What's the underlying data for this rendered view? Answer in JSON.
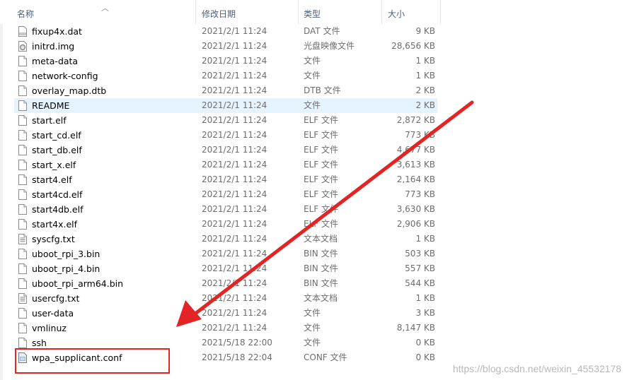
{
  "header": {
    "name": "名称",
    "date": "修改日期",
    "type": "类型",
    "size": "大小"
  },
  "files": [
    {
      "name": "fixup4x.dat",
      "date": "2021/2/1 11:24",
      "type": "DAT 文件",
      "size": "9 KB",
      "icon": "dat-file-icon"
    },
    {
      "name": "initrd.img",
      "date": "2021/2/1 11:24",
      "type": "光盘映像文件",
      "size": "28,656 KB",
      "icon": "disc-image-icon"
    },
    {
      "name": "meta-data",
      "date": "2021/2/1 11:24",
      "type": "文件",
      "size": "1 KB",
      "icon": "file-icon"
    },
    {
      "name": "network-config",
      "date": "2021/2/1 11:24",
      "type": "文件",
      "size": "1 KB",
      "icon": "file-icon"
    },
    {
      "name": "overlay_map.dtb",
      "date": "2021/2/1 11:24",
      "type": "DTB 文件",
      "size": "2 KB",
      "icon": "file-icon"
    },
    {
      "name": "README",
      "date": "2021/2/1 11:24",
      "type": "文件",
      "size": "2 KB",
      "icon": "file-icon",
      "selected": true
    },
    {
      "name": "start.elf",
      "date": "2021/2/1 11:24",
      "type": "ELF 文件",
      "size": "2,872 KB",
      "icon": "file-icon"
    },
    {
      "name": "start_cd.elf",
      "date": "2021/2/1 11:24",
      "type": "ELF 文件",
      "size": "773 KB",
      "icon": "file-icon"
    },
    {
      "name": "start_db.elf",
      "date": "2021/2/1 11:24",
      "type": "ELF 文件",
      "size": "4,677 KB",
      "icon": "file-icon"
    },
    {
      "name": "start_x.elf",
      "date": "2021/2/1 11:24",
      "type": "ELF 文件",
      "size": "3,613 KB",
      "icon": "file-icon"
    },
    {
      "name": "start4.elf",
      "date": "2021/2/1 11:24",
      "type": "ELF 文件",
      "size": "2,164 KB",
      "icon": "file-icon"
    },
    {
      "name": "start4cd.elf",
      "date": "2021/2/1 11:24",
      "type": "ELF 文件",
      "size": "773 KB",
      "icon": "file-icon"
    },
    {
      "name": "start4db.elf",
      "date": "2021/2/1 11:24",
      "type": "ELF 文件",
      "size": "3,630 KB",
      "icon": "file-icon"
    },
    {
      "name": "start4x.elf",
      "date": "2021/2/1 11:24",
      "type": "ELF 文件",
      "size": "2,906 KB",
      "icon": "file-icon"
    },
    {
      "name": "syscfg.txt",
      "date": "2021/2/1 11:24",
      "type": "文本文档",
      "size": "1 KB",
      "icon": "text-file-icon"
    },
    {
      "name": "uboot_rpi_3.bin",
      "date": "2021/2/1 11:24",
      "type": "BIN 文件",
      "size": "503 KB",
      "icon": "file-icon"
    },
    {
      "name": "uboot_rpi_4.bin",
      "date": "2021/2/1 11:24",
      "type": "BIN 文件",
      "size": "557 KB",
      "icon": "file-icon"
    },
    {
      "name": "uboot_rpi_arm64.bin",
      "date": "2021/2/1 11:24",
      "type": "BIN 文件",
      "size": "544 KB",
      "icon": "file-icon"
    },
    {
      "name": "usercfg.txt",
      "date": "2021/2/1 11:24",
      "type": "文本文档",
      "size": "1 KB",
      "icon": "text-file-icon"
    },
    {
      "name": "user-data",
      "date": "2021/2/1 11:24",
      "type": "文件",
      "size": "3 KB",
      "icon": "file-icon"
    },
    {
      "name": "vmlinuz",
      "date": "2021/2/1 11:24",
      "type": "文件",
      "size": "8,147 KB",
      "icon": "file-icon"
    },
    {
      "name": "ssh",
      "date": "2021/5/18 22:00",
      "type": "文件",
      "size": "0 KB",
      "icon": "file-icon"
    },
    {
      "name": "wpa_supplicant.conf",
      "date": "2021/5/18 22:04",
      "type": "CONF 文件",
      "size": "0 KB",
      "icon": "conf-file-icon"
    }
  ],
  "annotation": {
    "color": "#e22424"
  },
  "watermark": "https://blog.csdn.net/weixin_45532178"
}
